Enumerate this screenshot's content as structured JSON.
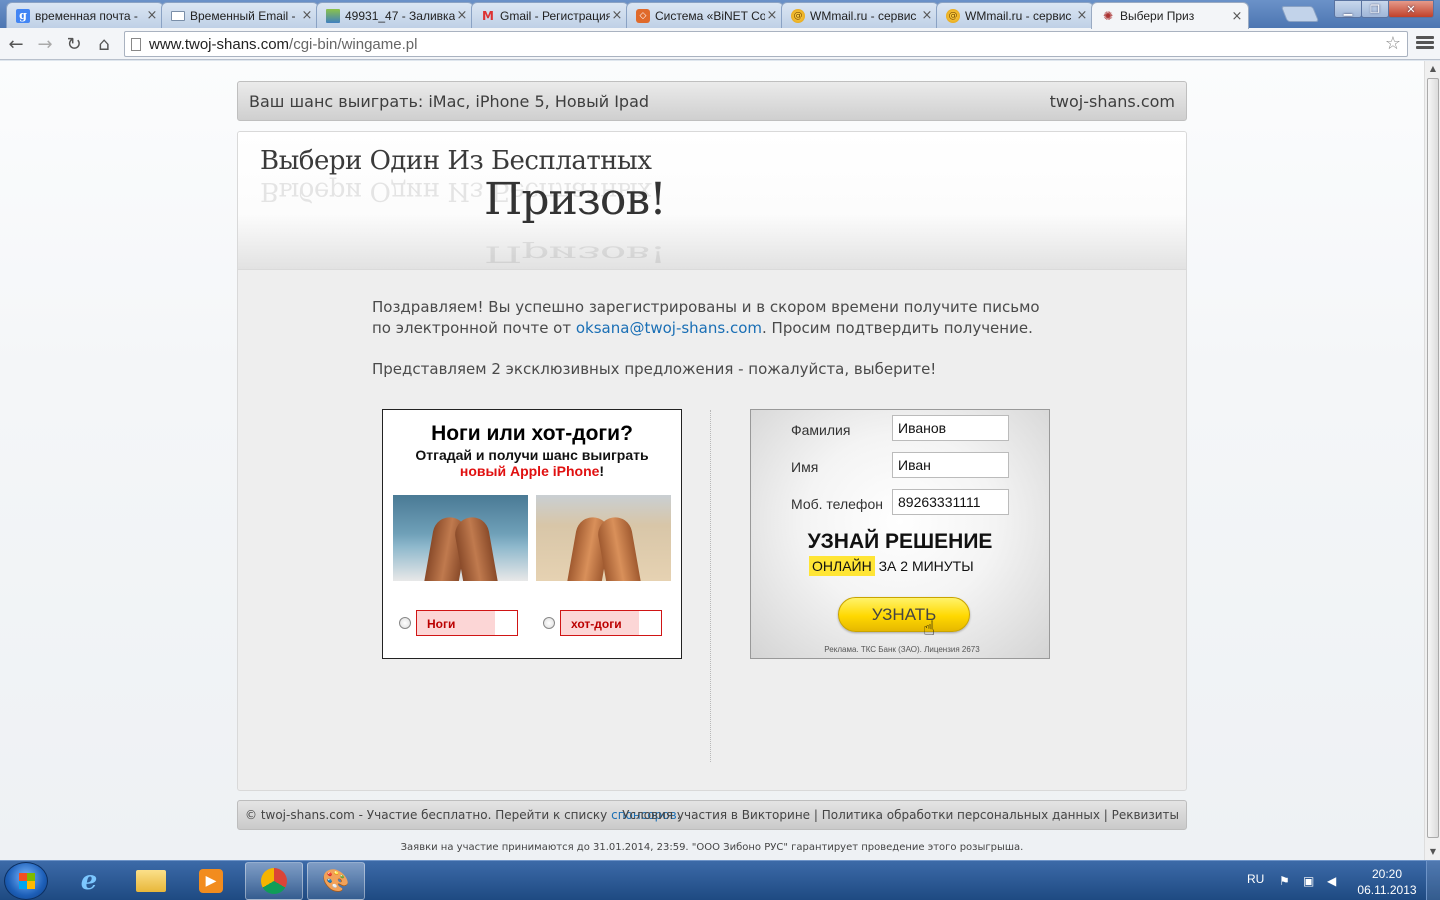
{
  "browser": {
    "tabs": [
      {
        "title": "временная почта - ",
        "icon": "google-icon"
      },
      {
        "title": "Временный Email - ",
        "icon": "mail-icon"
      },
      {
        "title": "49931_47 - Заливка",
        "icon": "image-icon"
      },
      {
        "title": "Gmail - Регистрация",
        "icon": "gmail-icon"
      },
      {
        "title": "Система «BiNET Co",
        "icon": "binet-icon"
      },
      {
        "title": "WMmail.ru - сервис",
        "icon": "wmmail-icon"
      },
      {
        "title": "WMmail.ru - сервис",
        "icon": "wmmail-icon"
      },
      {
        "title": "Выбери Приз",
        "icon": "spinner-icon",
        "active": true
      }
    ],
    "url_host": "www.twoj-shans.com",
    "url_path": "/cgi-bin/wingame.pl"
  },
  "site": {
    "tagline": "Ваш шанс выиграть:  iMac, iPhone 5, Новый Ipad",
    "domain": "twoj-shans.com",
    "hero_line1": "Выбери Один Из Бесплатных",
    "hero_line2": "Призов!",
    "intro_part1": "Поздравляем! Вы успешно зарегистрированы и в скором времени получите письмо по электронной почте от ",
    "intro_email": "oksana@twoj-shans.com",
    "intro_part2": ". Просим подтвердить получение.",
    "intro2": "Представляем 2 эксклюзивных предложения - пожалуйста, выберите!"
  },
  "offer_left": {
    "title": "Ноги или хот-доги?",
    "subtitle1": "Отгадай и получи шанс выиграть",
    "subtitle2_red": "новый Apple iPhone",
    "subtitle2_end": "!",
    "choice1": "Ноги",
    "choice2": "хот-доги"
  },
  "offer_right": {
    "surname_label": "Фамилия",
    "surname_value": "Иванов",
    "name_label": "Имя",
    "name_value": "Иван",
    "phone_label": "Моб. телефон",
    "phone_value": "89263331111",
    "solve_title": "УЗНАЙ РЕШЕНИЕ",
    "solve_highlight": "ОНЛАЙН",
    "solve_rest": " ЗА 2 МИНУТЫ",
    "button": "УЗНАТЬ",
    "ad_note": "Реклама. ТКС Банк (ЗАО). Лицензия 2673"
  },
  "footer": {
    "left_text": "© twoj-shans.com - Участие бесплатно. Перейти к списку ",
    "left_link": "спонсоров",
    "left_end": ".",
    "right_text": "Условия участия в Викторине | Политика обработки персональных данных | Реквизиты",
    "disclaimer": "Заявки на участие принимаются до 31.01.2014, 23:59. \"ООО Зибоно РУС\" гарантирует проведение этого розыгрыша."
  },
  "taskbar": {
    "lang": "RU",
    "time": "20:20",
    "date": "06.11.2013"
  }
}
